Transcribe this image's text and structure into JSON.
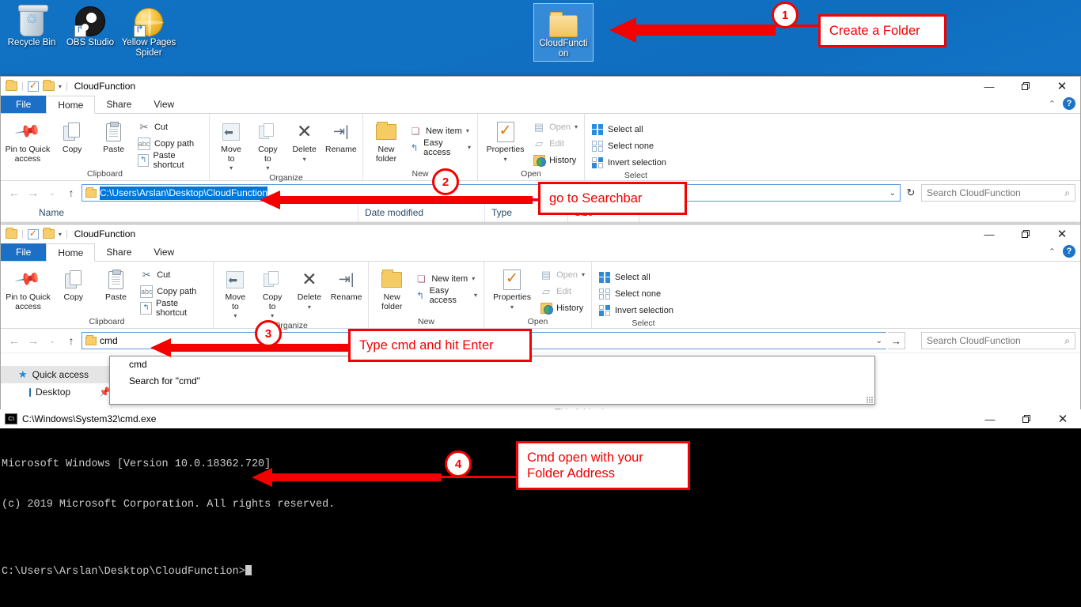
{
  "desktop": {
    "icons": [
      {
        "label": "Recycle Bin",
        "icon": "recycle-bin-icon"
      },
      {
        "label": "OBS Studio",
        "icon": "obs-studio-icon"
      },
      {
        "label": "Yellow Pages Spider",
        "icon": "yellow-pages-spider-icon"
      }
    ],
    "folder": {
      "label": "CloudFuncti on",
      "icon": "folder-icon"
    }
  },
  "window1": {
    "title": "CloudFunction",
    "tabs": [
      "File",
      "Home",
      "Share",
      "View"
    ],
    "active_tab": "Home",
    "controls": {
      "minimize": "—",
      "maximize": "❐",
      "close": "✕",
      "ribbon_toggle": "⌃",
      "help": "?"
    },
    "ribbon": {
      "clipboard": {
        "label": "Clipboard",
        "pin": "Pin to Quick\naccess",
        "copy": "Copy",
        "paste": "Paste",
        "cut": "Cut",
        "copy_path": "Copy path",
        "paste_shortcut": "Paste shortcut"
      },
      "organize": {
        "label": "Organize",
        "move_to": "Move\nto",
        "copy_to": "Copy\nto",
        "delete": "Delete",
        "rename": "Rename"
      },
      "new": {
        "label": "New",
        "new_folder": "New\nfolder",
        "new_item": "New item",
        "easy_access": "Easy access"
      },
      "open": {
        "label": "Open",
        "properties": "Properties",
        "open": "Open",
        "edit": "Edit",
        "history": "History"
      },
      "select": {
        "label": "Select",
        "select_all": "Select all",
        "select_none": "Select none",
        "invert_selection": "Invert selection"
      }
    },
    "address": {
      "value": "C:\\Users\\Arslan\\Desktop\\CloudFunction",
      "selected": true
    },
    "search": {
      "placeholder": "Search CloudFunction"
    },
    "columns": [
      "Name",
      "Date modified",
      "Type",
      "Size"
    ]
  },
  "window2": {
    "title": "CloudFunction",
    "tabs": [
      "File",
      "Home",
      "Share",
      "View"
    ],
    "active_tab": "Home",
    "controls": {
      "minimize": "—",
      "maximize": "❐",
      "close": "✕",
      "ribbon_toggle": "⌃",
      "help": "?"
    },
    "address": {
      "value": "cmd"
    },
    "autocomplete": [
      "cmd",
      "Search for \"cmd\""
    ],
    "search": {
      "placeholder": "Search CloudFunction"
    },
    "navpane": [
      "Quick access",
      "Desktop"
    ],
    "empty_text": "This folder is empty."
  },
  "cmd": {
    "title": "C:\\Windows\\System32\\cmd.exe",
    "controls": {
      "minimize": "—",
      "maximize": "❐",
      "close": "✕"
    },
    "lines": [
      "Microsoft Windows [Version 10.0.18362.720]",
      "(c) 2019 Microsoft Corporation. All rights reserved.",
      "",
      "C:\\Users\\Arslan\\Desktop\\CloudFunction>"
    ]
  },
  "annotations": [
    {
      "number": "1",
      "text": "Create a Folder"
    },
    {
      "number": "2",
      "text": "go to Searchbar"
    },
    {
      "number": "3",
      "text": "Type cmd and hit Enter"
    },
    {
      "number": "4",
      "text": "Cmd open with your\nFolder Address"
    }
  ],
  "colors": {
    "annotation_red": "#f40000",
    "desktop_blue": "#1172c4",
    "accent_blue": "#0078d7",
    "file_tab_blue": "#1c6fc4"
  }
}
